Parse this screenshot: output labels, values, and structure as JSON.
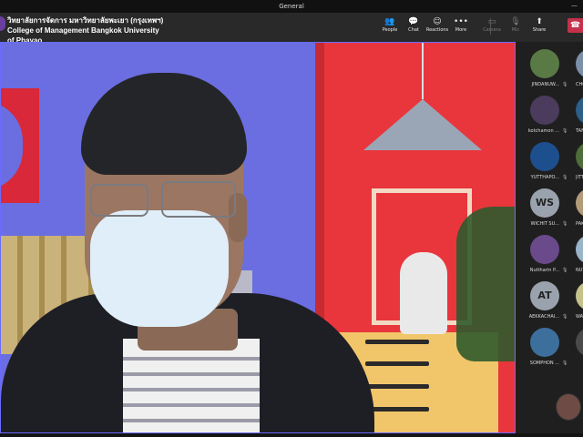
{
  "window": {
    "title": "General",
    "minimize": "—"
  },
  "meeting": {
    "org_line1": "วิทยาลัยการจัดการ มหาวิทยาลัยพะเยา (กรุงเทพฯ)",
    "org_line2": "College of Management Bangkok University",
    "org_line3": "of Phayao"
  },
  "toolbar": [
    {
      "label": "People",
      "icon": "people-icon",
      "glyph": "👥",
      "enabled": true
    },
    {
      "label": "Chat",
      "icon": "chat-icon",
      "glyph": "💬",
      "enabled": true
    },
    {
      "label": "Reactions",
      "icon": "reactions-icon",
      "glyph": "☺",
      "enabled": true
    },
    {
      "label": "More",
      "icon": "more-icon",
      "glyph": "•••",
      "enabled": true
    },
    {
      "label": "Camera",
      "icon": "camera-off-icon",
      "glyph": "▭",
      "enabled": false
    },
    {
      "label": "Mic",
      "icon": "mic-off-icon",
      "glyph": "🎙",
      "enabled": false
    },
    {
      "label": "Share",
      "icon": "share-icon",
      "glyph": "⬆",
      "enabled": true
    }
  ],
  "leave": {
    "icon": "hang-up-icon",
    "glyph": "☎"
  },
  "participants": [
    {
      "name": "JINDANUW...",
      "initials": "",
      "color": "#5a7a45"
    },
    {
      "name": "CHO",
      "initials": "",
      "color": "#7c8fa8"
    },
    {
      "name": "kotchamon ...",
      "initials": "",
      "color": "#4b3b5c"
    },
    {
      "name": "TANA",
      "initials": "",
      "color": "#2d5f8a"
    },
    {
      "name": "YUTTHAPO...",
      "initials": "",
      "color": "#1d4f8f"
    },
    {
      "name": "JITTI",
      "initials": "",
      "color": "#4e6d3a"
    },
    {
      "name": "WICHIT SU...",
      "initials": "WS",
      "color": "#9aa3ad"
    },
    {
      "name": "PAKA",
      "initials": "",
      "color": "#b39b7a"
    },
    {
      "name": "Nuttharin P...",
      "initials": "",
      "color": "#6a4a8a"
    },
    {
      "name": "NUTC",
      "initials": "",
      "color": "#9ab4c8"
    },
    {
      "name": "AEKKACHAI...",
      "initials": "AT",
      "color": "#9aa3ad"
    },
    {
      "name": "WATT",
      "initials": "",
      "color": "#c4c28a"
    },
    {
      "name": "SOMPHON ...",
      "initials": "",
      "color": "#3d6f9c"
    },
    {
      "name": "",
      "initials": "",
      "color": "#4a4a4a"
    }
  ],
  "colors": {
    "accent": "#6b6bff",
    "leave": "#c4314b",
    "app_bg": "#1f1f1f"
  }
}
